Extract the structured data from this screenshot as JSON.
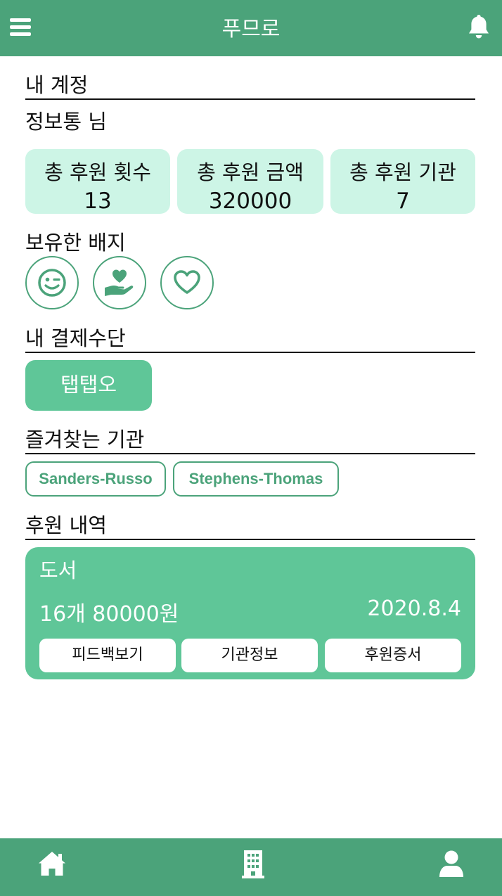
{
  "header": {
    "title": "푸므로",
    "menu_icon": "hamburger-menu-icon",
    "notification_icon": "bell-icon"
  },
  "account": {
    "section_title": "내 계정",
    "user_name": "정보통 님"
  },
  "stats": [
    {
      "label": "총 후원 횟수",
      "value": "13"
    },
    {
      "label": "총 후원 금액",
      "value": "320000"
    },
    {
      "label": "총 후원 기관",
      "value": "7"
    }
  ],
  "badges": {
    "section_title": "보유한 배지",
    "items": [
      "winking-smile-icon",
      "heart-in-hand-icon",
      "heart-outline-icon"
    ]
  },
  "payment": {
    "section_title": "내 결제수단",
    "method": "탭탭오"
  },
  "favorites": {
    "section_title": "즐겨찾는 기관",
    "items": [
      "Sanders-Russo",
      "Stephens-Thomas"
    ]
  },
  "history": {
    "section_title": "후원 내역",
    "items": [
      {
        "category": "도서",
        "summary": "16개 80000원",
        "date": "2020.8.4",
        "buttons": [
          "피드백보기",
          "기관정보",
          "후원증서"
        ]
      }
    ]
  },
  "tabbar": {
    "items": [
      "home-icon",
      "building-icon",
      "user-icon"
    ]
  },
  "colors": {
    "primary": "#4ba37a",
    "accent": "#5fc698",
    "stat_bg": "#cdf5e6",
    "text": "#111111"
  }
}
